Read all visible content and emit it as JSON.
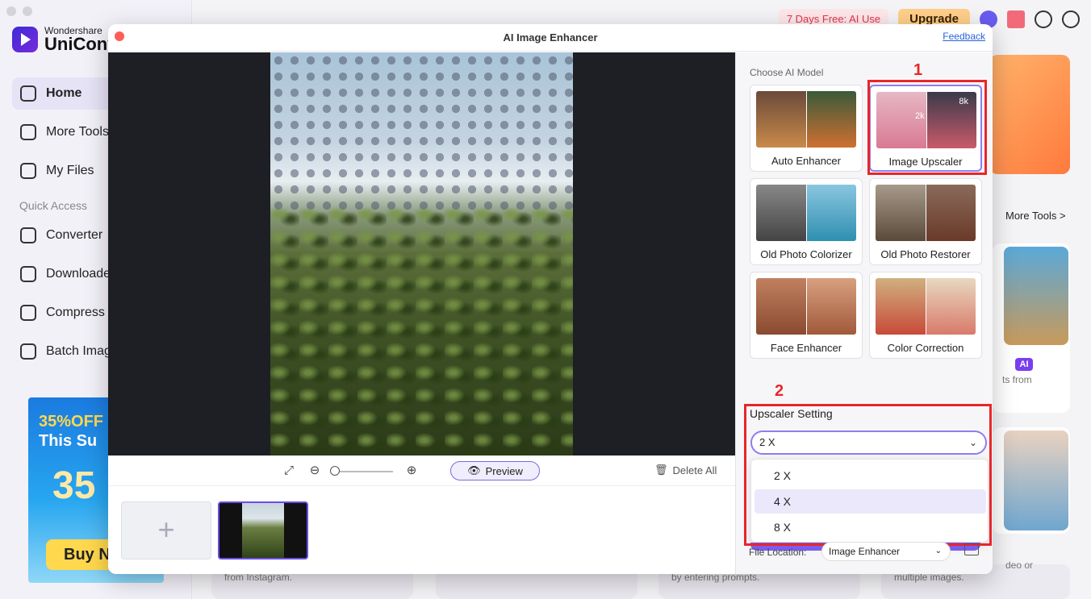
{
  "app": {
    "brand_small": "Wondershare",
    "brand_big": "UniConve",
    "nav": [
      {
        "label": "Home",
        "icon": "home-icon"
      },
      {
        "label": "More Tools",
        "icon": "toolbox-icon"
      },
      {
        "label": "My Files",
        "icon": "file-icon"
      }
    ],
    "quick_access_label": "Quick Access",
    "quick": [
      {
        "label": "Converter",
        "icon": "converter-icon"
      },
      {
        "label": "Downloade",
        "icon": "download-icon"
      },
      {
        "label": "Compress",
        "icon": "compress-icon"
      },
      {
        "label": "Batch Imag",
        "icon": "batch-image-icon"
      }
    ],
    "promo": {
      "line1": "35%OFF",
      "line2": "This Su",
      "big": "35",
      "button": "Buy N"
    },
    "top": {
      "free_badge": "7 Days Free: AI Use",
      "upgrade": "Upgrade"
    },
    "bg_texts": {
      "more_tools": "More Tools >",
      "ai_badge": "AI",
      "ts_from": "ts from",
      "from_instagram": "from Instagram.",
      "prompts": "by entering prompts.",
      "video_or": "deo or",
      "multiple_images": "multiple images."
    }
  },
  "modal": {
    "title": "AI Image Enhancer",
    "feedback": "Feedback",
    "toolbar": {
      "preview": "Preview",
      "delete_all": "Delete All"
    },
    "choose_label": "Choose AI Model",
    "models": [
      {
        "label": "Auto Enhancer"
      },
      {
        "label": "Image Upscaler",
        "badge_big": "8k",
        "badge_small": "2k"
      },
      {
        "label": "Old Photo Colorizer"
      },
      {
        "label": "Old Photo Restorer"
      },
      {
        "label": "Face Enhancer"
      },
      {
        "label": "Color Correction"
      }
    ],
    "annotations": {
      "one": "1",
      "two": "2"
    },
    "upscaler_label": "Upscaler Setting",
    "upscaler_value": "2 X",
    "options": [
      "2 X",
      "4 X",
      "8 X"
    ],
    "highlighted_option": "4 X",
    "file_location_label": "File Location:",
    "file_location_value": "Image Enhancer"
  },
  "colors": {
    "accent": "#7a5cf0",
    "annotation": "#e8262a",
    "close": "#fd5f57"
  }
}
